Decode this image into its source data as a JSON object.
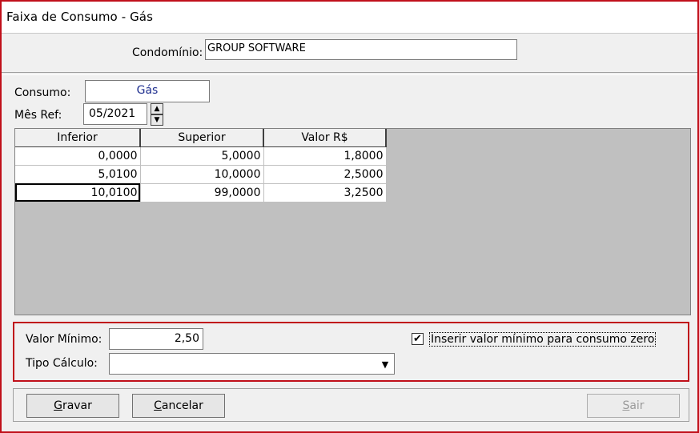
{
  "window": {
    "title": "Faixa de Consumo - Gás"
  },
  "header": {
    "condominio_label": "Condomínio:",
    "condominio_value": "GROUP SOFTWARE"
  },
  "form": {
    "consumo_label": "Consumo:",
    "consumo_value": "Gás",
    "mes_ref_label": "Mês Ref:",
    "mes_ref_value": "05/2021"
  },
  "grid": {
    "columns": [
      "Inferior",
      "Superior",
      "Valor R$"
    ],
    "rows": [
      [
        "0,0000",
        "5,0000",
        "1,8000"
      ],
      [
        "5,0100",
        "10,0000",
        "2,5000"
      ],
      [
        "10,0100",
        "99,0000",
        "3,2500"
      ]
    ],
    "selected_row": 2,
    "selected_col": 0
  },
  "options": {
    "valor_minimo_label": "Valor Mínimo:",
    "valor_minimo_value": "2,50",
    "tipo_calculo_label": "Tipo Cálculo:",
    "tipo_calculo_value": "",
    "checkbox_label": "Inserir valor mínimo para consumo zero",
    "checkbox_checked": true
  },
  "buttons": {
    "gravar_first": "G",
    "gravar_rest": "ravar",
    "cancelar_first": "C",
    "cancelar_rest": "ancelar",
    "sair_first": "S",
    "sair_rest": "air"
  },
  "icons": {
    "spin_up": "spin-up-icon",
    "spin_down": "spin-down-icon",
    "dropdown": "dropdown-arrow-icon",
    "check": "checkmark-icon"
  },
  "colors": {
    "frame_accent": "#c0101a",
    "consumo_text": "#1f2f8f"
  }
}
